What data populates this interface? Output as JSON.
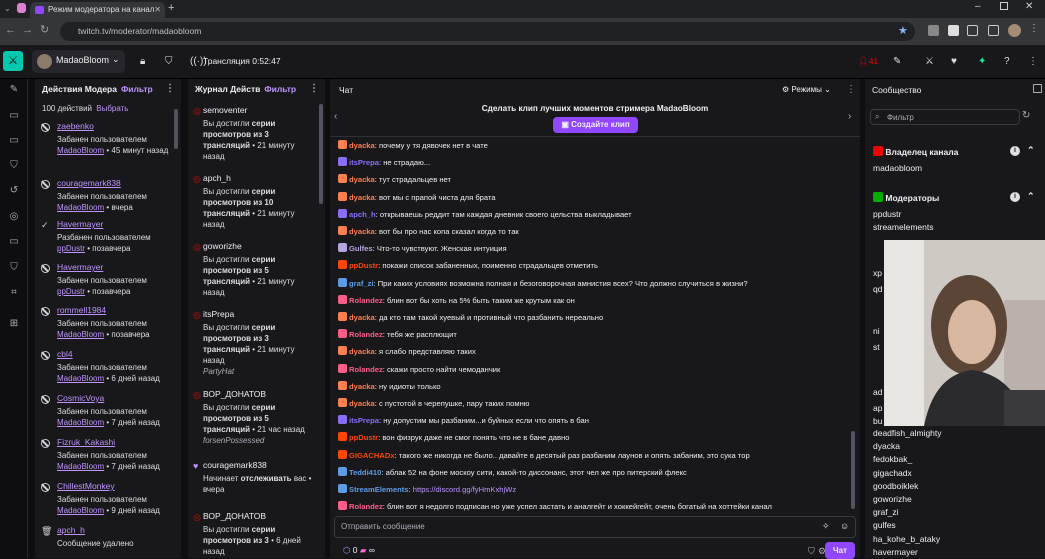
{
  "browser": {
    "tab_title": "Режим модератора на канал",
    "url": "twitch.tv/moderator/madaobloom"
  },
  "header": {
    "channel": "MadaoBloom",
    "stream_time": "Трансляция 0:52:47",
    "viewers": "41"
  },
  "mod_actions": {
    "title": "Действия Модера",
    "filter": "Фильтр",
    "count": "100 действий",
    "select": "Выбрать",
    "entries": [
      {
        "icon": "ban",
        "user": "zaebenko",
        "line1": "Забанен пользователем",
        "by": "MadaoBloom",
        "when": " • 45 минут назад"
      },
      {
        "icon": "ban",
        "user": "couragemark838",
        "line1": "Забанен пользователем",
        "by": "MadaoBloom",
        "when": " • вчера"
      },
      {
        "icon": "check",
        "user": "Havermayer",
        "line1": "Разбанен пользователем",
        "by": "ppDustr",
        "when": " • позавчера"
      },
      {
        "icon": "ban",
        "user": "Havermayer",
        "line1": "Забанен пользователем",
        "by": "ppDustr",
        "when": " • позавчера"
      },
      {
        "icon": "ban",
        "user": "rommell1984",
        "line1": "Забанен пользователем",
        "by": "MadaoBloom",
        "when": " • позавчера"
      },
      {
        "icon": "ban",
        "user": "cbl4",
        "line1": "Забанен пользователем",
        "by": "MadaoBloom",
        "when": " • 6 дней назад"
      },
      {
        "icon": "ban",
        "user": "CosmicVoya",
        "line1": "Забанен пользователем",
        "by": "MadaoBloom",
        "when": " • 7 дней назад"
      },
      {
        "icon": "ban",
        "user": "Fizruk_Kakashi",
        "line1": "Забанен пользователем",
        "by": "MadaoBloom",
        "when": " • 7 дней назад"
      },
      {
        "icon": "ban",
        "user": "ChillestMonkey",
        "line1": "Забанен пользователем",
        "by": "MadaoBloom",
        "when": " • 9 дней назад"
      },
      {
        "icon": "trash",
        "user": "apch_h",
        "line1": "Сообщение удалено",
        "by": "",
        "when": ""
      }
    ]
  },
  "activity": {
    "title": "Журнал Действ",
    "filter": "Фильтр",
    "entries": [
      {
        "user": "semoventer",
        "pre": "Вы достигли ",
        "bold": "серии просмотров из 3 трансляций",
        "post": " • 21 минуту назад",
        "note": ""
      },
      {
        "user": "apch_h",
        "pre": "Вы достигли ",
        "bold": "серии просмотров из 10 трансляций",
        "post": " • 21 минуту назад",
        "note": ""
      },
      {
        "user": "goworizhe",
        "pre": "Вы достигли ",
        "bold": "серии просмотров из 5 трансляций",
        "post": " • 21 минуту назад",
        "note": ""
      },
      {
        "user": "itsPrepa",
        "pre": "Вы достигли ",
        "bold": "серии просмотров из 3 трансляций",
        "post": " • 21 минуту назад",
        "note": "PartyHat"
      },
      {
        "user": "ВОР_ДОНАТОВ",
        "pre": "Вы достигли ",
        "bold": "серии просмотров из 5 трансляций",
        "post": " • 21 час назад",
        "note": "forsenPossessed"
      },
      {
        "user": "couragemark838",
        "pre": "Начинает ",
        "bold": "отслеживать",
        "post": " вас • вчера",
        "note": ""
      },
      {
        "user": "ВОР_ДОНАТОВ",
        "pre": "Вы достигли ",
        "bold": "серии просмотров из 3",
        "post": " • 6 дней назад",
        "note": ""
      }
    ]
  },
  "chat": {
    "title": "Чат",
    "modes": "Режимы",
    "clip_prompt": "Сделать клип лучших моментов стримера MadaoBloom",
    "clip_button": "Создайте клип",
    "input_placeholder": "Отправить сообщение",
    "points": "0",
    "send": "Чат",
    "messages": [
      {
        "name": "dyacka",
        "color": "#ff7f50",
        "text": "почему у тя дявочек нет в чате"
      },
      {
        "name": "itsPrepa",
        "color": "#8a6dff",
        "text": "не страдаю..."
      },
      {
        "name": "dyacka",
        "color": "#ff7f50",
        "text": "тут страдальцев нет"
      },
      {
        "name": "dyacka",
        "color": "#ff7f50",
        "text": "вот мы с прапой чиста для брата"
      },
      {
        "name": "apch_h",
        "color": "#8a6dff",
        "text": "открываешь реддит там каждая дневник своего цельства выкладывает"
      },
      {
        "name": "dyacka",
        "color": "#ff7f50",
        "text": "вот бы про нас копа сказал когда то так"
      },
      {
        "name": "Gulfes",
        "color": "#b8a5e0",
        "text": "Что-то чувствуют. Женская интуиция"
      },
      {
        "name": "ppDustr",
        "color": "#ff4500",
        "text": "покажи список забаненных, поименно страдальцев отметить"
      },
      {
        "name": "graf_zi",
        "color": "#5c9ce6",
        "text": "При каких условиях возможна полная и безоговорочная амнистия всех? Что должно случиться в жизни?"
      },
      {
        "name": "Rolandez",
        "color": "#ff5c8a",
        "text": "блин вот бы хоть на 5% быть таким же крутым как он"
      },
      {
        "name": "dyacka",
        "color": "#ff7f50",
        "text": "да кто там такой хуевый и противный что разбанить нереально"
      },
      {
        "name": "Rolandez",
        "color": "#ff5c8a",
        "text": "тебя же расплющит"
      },
      {
        "name": "dyacka",
        "color": "#ff7f50",
        "text": "я слабо представляю таких"
      },
      {
        "name": "Rolandez",
        "color": "#ff5c8a",
        "text": "скажи просто найти чемоданчик"
      },
      {
        "name": "dyacka",
        "color": "#ff7f50",
        "text": "ну идиоты только"
      },
      {
        "name": "dyacka",
        "color": "#ff7f50",
        "text": "с пустотой в черепушке, пару таких помню"
      },
      {
        "name": "itsPrepa",
        "color": "#8a6dff",
        "text": "ну допустим мы разбаним...и буйных если что опять в бан"
      },
      {
        "name": "ppDustr",
        "color": "#ff4500",
        "text": "вон физрук даже не смог понять что не в бане давно"
      },
      {
        "name": "GIGACHADx",
        "color": "#ff4500",
        "text": "такого же никогда не было.. давайте в десятый раз разбаним лаунов и опять забаним, это сука тор"
      },
      {
        "name": "Teddi410",
        "color": "#5c9ce6",
        "text": "аблак 52 на фоне москоу сити, какой-то диссонанс, этот чел же про питерский флекс"
      },
      {
        "name": "StreamElements",
        "color": "#5c9ce6",
        "text": "https://discord.gg/fyHmKxhjWz"
      },
      {
        "name": "Rolandez",
        "color": "#ff5c8a",
        "text": "блин вот я недолго подписан но уже успел застать и аналгейт и хоккейгейт, очень богатый на хоттейки канал"
      }
    ]
  },
  "community": {
    "title": "Сообщество",
    "filter": "Фильтр",
    "owner_section": "Владелец канала",
    "owner": "madaobloom",
    "mods_section": "Модераторы",
    "mods": [
      "ppdustr",
      "streamelements"
    ],
    "partial": [
      "xp",
      "qd",
      "ni",
      "st",
      "ad",
      "ap",
      "bu"
    ],
    "chatters": [
      "deadfish_almighty",
      "dyacka",
      "fedokbak_",
      "gigachadx",
      "goodboiklek",
      "goworizhe",
      "graf_zi",
      "gulfes",
      "ha_kohe_b_ataky",
      "havermayer"
    ]
  }
}
